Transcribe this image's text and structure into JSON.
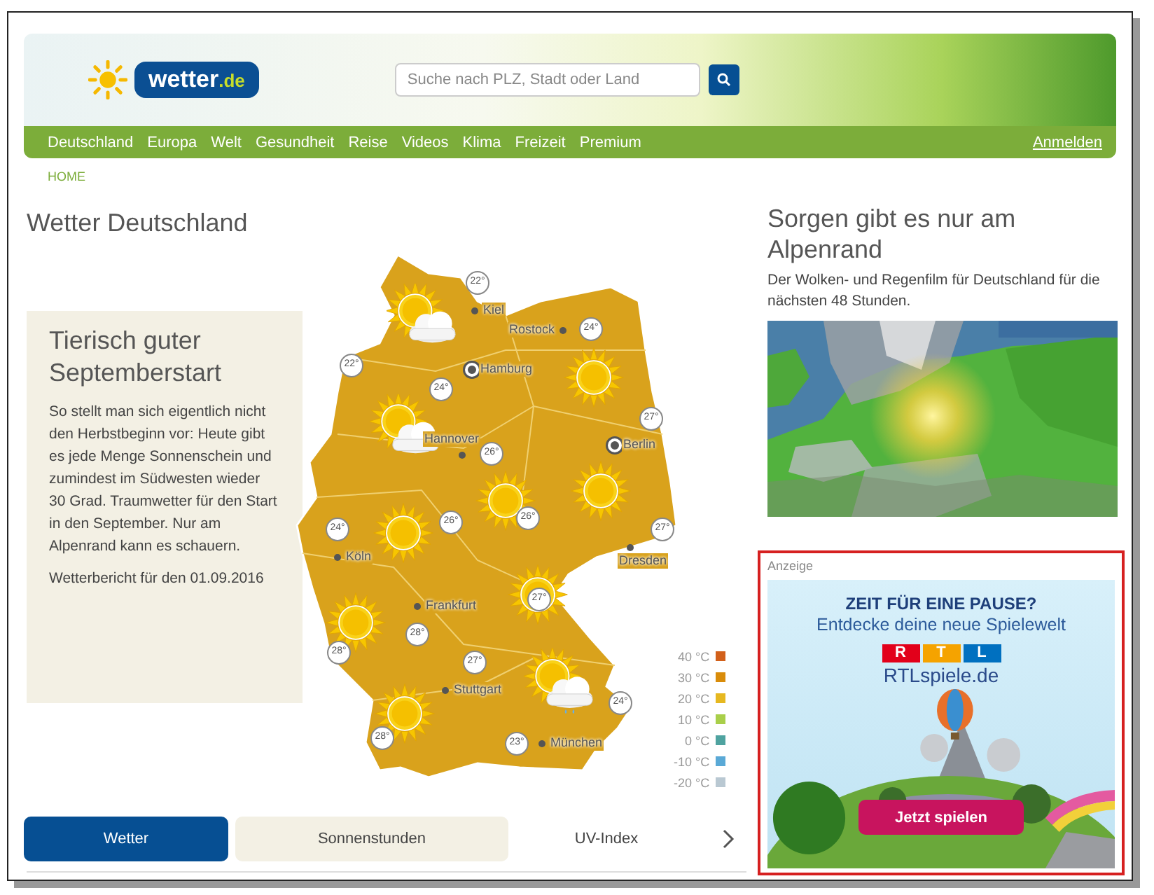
{
  "header": {
    "logo": {
      "name": "wetter",
      "suffix": ".de"
    },
    "search": {
      "placeholder": "Suche nach PLZ, Stadt oder Land"
    }
  },
  "nav": {
    "items": [
      "Deutschland",
      "Europa",
      "Welt",
      "Gesundheit",
      "Reise",
      "Videos",
      "Klima",
      "Freizeit",
      "Premium"
    ],
    "login": "Anmelden"
  },
  "breadcrumb": "HOME",
  "page_title": "Wetter Deutschland",
  "story": {
    "title": "Tierisch guter Septemberstart",
    "text": "So stellt man sich eigentlich nicht den Herbstbeginn vor: Heute gibt es jede Menge Sonnenschein und zumindest im Südwesten wieder 30 Grad. Traumwetter für den Start in den September. Nur am Alpenrand kann es schauern.",
    "date": "Wetterbericht für den 01.09.2016"
  },
  "map": {
    "cities": [
      {
        "name": "Kiel",
        "kind": "city"
      },
      {
        "name": "Rostock",
        "kind": "city"
      },
      {
        "name": "Hamburg",
        "kind": "major"
      },
      {
        "name": "Hannover",
        "kind": "city"
      },
      {
        "name": "Berlin",
        "kind": "major"
      },
      {
        "name": "Köln",
        "kind": "city"
      },
      {
        "name": "Dresden",
        "kind": "city"
      },
      {
        "name": "Frankfurt",
        "kind": "city"
      },
      {
        "name": "Stuttgart",
        "kind": "city"
      },
      {
        "name": "München",
        "kind": "city"
      }
    ],
    "temperatures": [
      "22°",
      "24°",
      "22°",
      "24°",
      "27°",
      "26°",
      "24°",
      "26°",
      "26°",
      "27°",
      "27°",
      "28°",
      "28°",
      "27°",
      "24°",
      "28°",
      "23°"
    ],
    "weather_icons": [
      {
        "kind": "sun-cloud"
      },
      {
        "kind": "sun"
      },
      {
        "kind": "sun-cloud"
      },
      {
        "kind": "sun"
      },
      {
        "kind": "sun"
      },
      {
        "kind": "sun"
      },
      {
        "kind": "sun"
      },
      {
        "kind": "sun"
      },
      {
        "kind": "sun-cloud-rain"
      },
      {
        "kind": "sun"
      }
    ],
    "legend": [
      {
        "label": "40 °C",
        "color": "#d2601a"
      },
      {
        "label": "30 °C",
        "color": "#d98c0a"
      },
      {
        "label": "20 °C",
        "color": "#e6b820"
      },
      {
        "label": "10 °C",
        "color": "#a9cf4a"
      },
      {
        "label": "0 °C",
        "color": "#4fa3a0"
      },
      {
        "label": "-10 °C",
        "color": "#5aa9d6"
      },
      {
        "label": "-20 °C",
        "color": "#b9c8d2"
      }
    ]
  },
  "tabs": [
    {
      "label": "Wetter",
      "selected": true
    },
    {
      "label": "Sonnenstunden",
      "selected": false
    },
    {
      "label": "UV-Index",
      "selected": false
    }
  ],
  "feature": {
    "title": "Sorgen gibt es nur am Alpenrand",
    "text": "Der Wolken- und Regenfilm für Deutschland für die nächsten 48 Stunden."
  },
  "ad": {
    "label": "Anzeige",
    "headline": "ZEIT FÜR EINE PAUSE?",
    "subline": "Entdecke deine neue Spielewelt",
    "brand_letters": [
      "R",
      "T",
      "L"
    ],
    "site": "RTLspiele.de",
    "button": "Jetzt spielen"
  }
}
